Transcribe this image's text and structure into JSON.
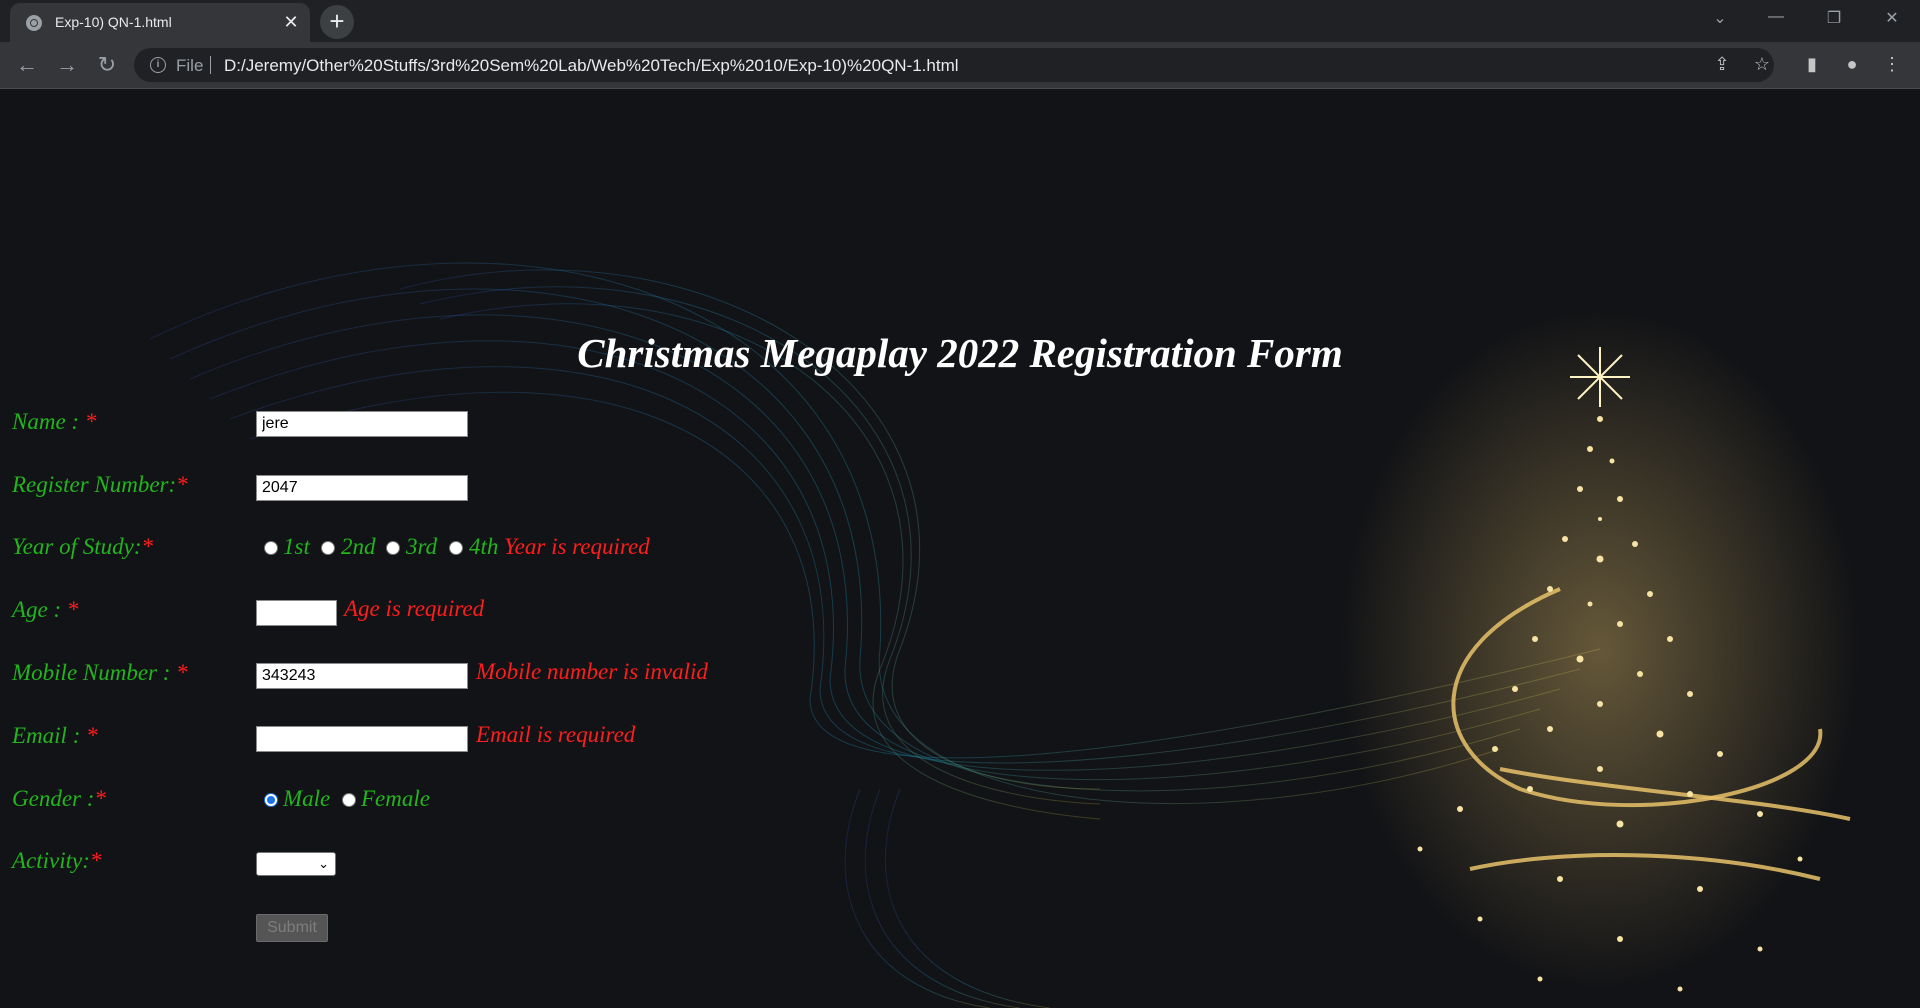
{
  "browser": {
    "tab_title": "Exp-10) QN-1.html",
    "tab_close": "✕",
    "new_tab": "+",
    "scheme_label": "File",
    "url": "D:/Jeremy/Other%20Stuffs/3rd%20Sem%20Lab/Web%20Tech/Exp%2010/Exp-10)%20QN-1.html",
    "back": "←",
    "forward": "→",
    "reload": "↻",
    "info": "i",
    "share": "⇪",
    "bookmark": "☆",
    "sidepanel": "▮",
    "profile": "●",
    "menu": "⋮",
    "tab_search": "⌄",
    "minimize": "—",
    "restore": "❐",
    "close": "✕"
  },
  "form": {
    "title": "Christmas Megaplay 2022 Registration Form",
    "required_mark": "*",
    "labels": {
      "name": "Name : ",
      "register": "Register Number:",
      "year": "Year of Study:",
      "age": "Age : ",
      "mobile": "Mobile Number : ",
      "email": "Email : ",
      "gender": "Gender :",
      "activity": "Activity:"
    },
    "values": {
      "name": "jere",
      "register": "2047",
      "age": "",
      "mobile": "343243",
      "email": ""
    },
    "year_options": [
      "1st",
      "2nd",
      "3rd",
      "4th"
    ],
    "gender_options": [
      "Male",
      "Female"
    ],
    "gender_selected": "Male",
    "activity_selected": "",
    "errors": {
      "year": "Year is required",
      "age": "Age is required",
      "mobile": "Mobile number is invalid",
      "email": "Email is required"
    },
    "submit_label": "Submit"
  },
  "colors": {
    "label_green": "#22b51e",
    "error_red": "#ff1d1d",
    "background": "#121316"
  }
}
